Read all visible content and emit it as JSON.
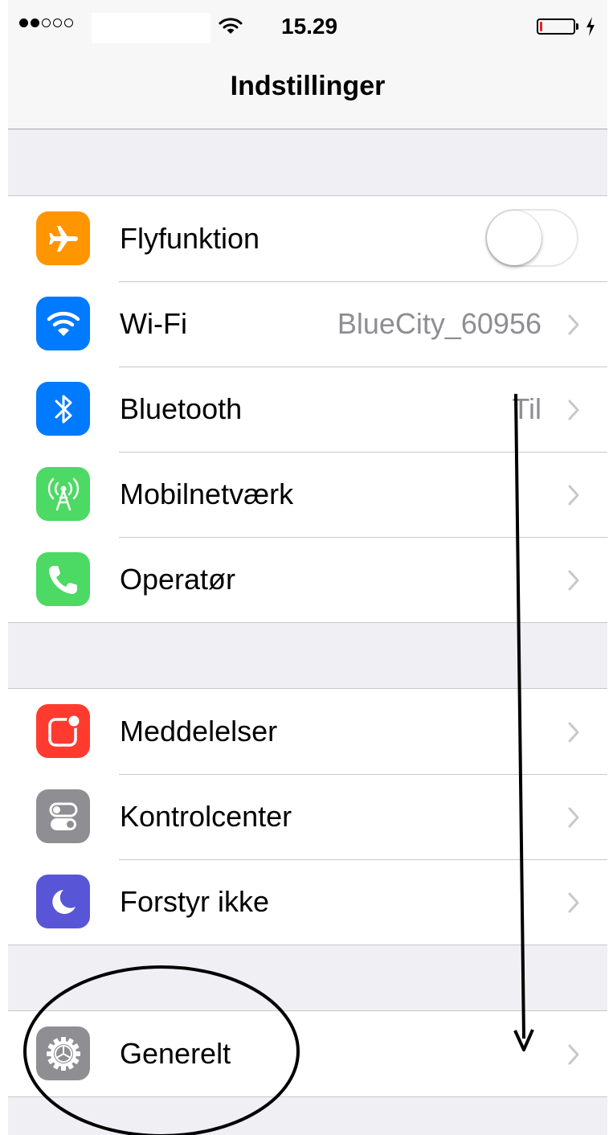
{
  "status_bar": {
    "signal_dots": [
      true,
      true,
      false,
      false,
      false
    ],
    "time": "15.29",
    "battery_level_percent": 8,
    "battery_color": "#e0252b"
  },
  "nav": {
    "title": "Indstillinger"
  },
  "groups": [
    {
      "items": [
        {
          "name": "flyfunktion",
          "label": "Flyfunktion",
          "icon": "airplane-icon",
          "icon_color": "#ff9500",
          "control": "toggle",
          "toggle_on": false
        },
        {
          "name": "wifi",
          "label": "Wi-Fi",
          "detail": "BlueCity_60956",
          "icon": "wifi-icon",
          "icon_color": "#007aff",
          "control": "chevron"
        },
        {
          "name": "bluetooth",
          "label": "Bluetooth",
          "detail": "Til",
          "icon": "bluetooth-icon",
          "icon_color": "#007aff",
          "control": "chevron"
        },
        {
          "name": "mobilnetvaerk",
          "label": "Mobilnetværk",
          "icon": "cellular-antenna-icon",
          "icon_color": "#4cd964",
          "control": "chevron"
        },
        {
          "name": "operator",
          "label": "Operatør",
          "icon": "phone-icon",
          "icon_color": "#4cd964",
          "control": "chevron"
        }
      ]
    },
    {
      "items": [
        {
          "name": "meddelelser",
          "label": "Meddelelser",
          "icon": "notifications-icon",
          "icon_color": "#ff3b30",
          "control": "chevron"
        },
        {
          "name": "kontrolcenter",
          "label": "Kontrolcenter",
          "icon": "control-center-icon",
          "icon_color": "#8e8e93",
          "control": "chevron"
        },
        {
          "name": "forstyr-ikke",
          "label": "Forstyr ikke",
          "icon": "moon-icon",
          "icon_color": "#5856d6",
          "control": "chevron"
        }
      ]
    },
    {
      "items": [
        {
          "name": "generelt",
          "label": "Generelt",
          "icon": "gear-icon",
          "icon_color": "#8e8e93",
          "control": "chevron"
        }
      ]
    }
  ],
  "annotations": {
    "arrow": "down-arrow-annotation",
    "circle": "highlight-circle-annotation"
  }
}
